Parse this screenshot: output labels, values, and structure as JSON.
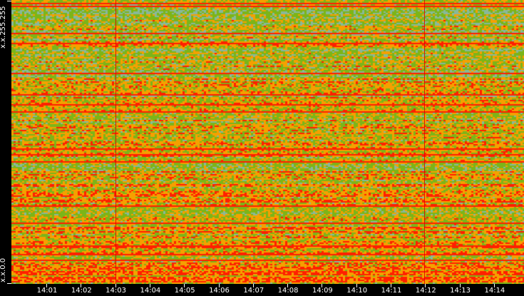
{
  "chart_data": {
    "type": "heatmap",
    "title": "",
    "xlabel": "",
    "ylabel": "",
    "y_labels": [
      "x.x.255.255",
      "x.x.0.0"
    ],
    "x_ticks": [
      "14:01",
      "14:02",
      "14:03",
      "14:04",
      "14:05",
      "14:06",
      "14:07",
      "14:08",
      "14:09",
      "14:10",
      "14:11",
      "14:12",
      "14:13",
      "14:14"
    ],
    "x_range": [
      "14:00",
      "14:14"
    ],
    "y_range": [
      "x.x.0.0",
      "x.x.255.255"
    ],
    "event_markers": [
      "14:03",
      "14:12"
    ],
    "color_scale": [
      "#88b89a",
      "#7cb518",
      "#f5a000",
      "#ff2000"
    ],
    "grid": false,
    "legend": "none"
  }
}
